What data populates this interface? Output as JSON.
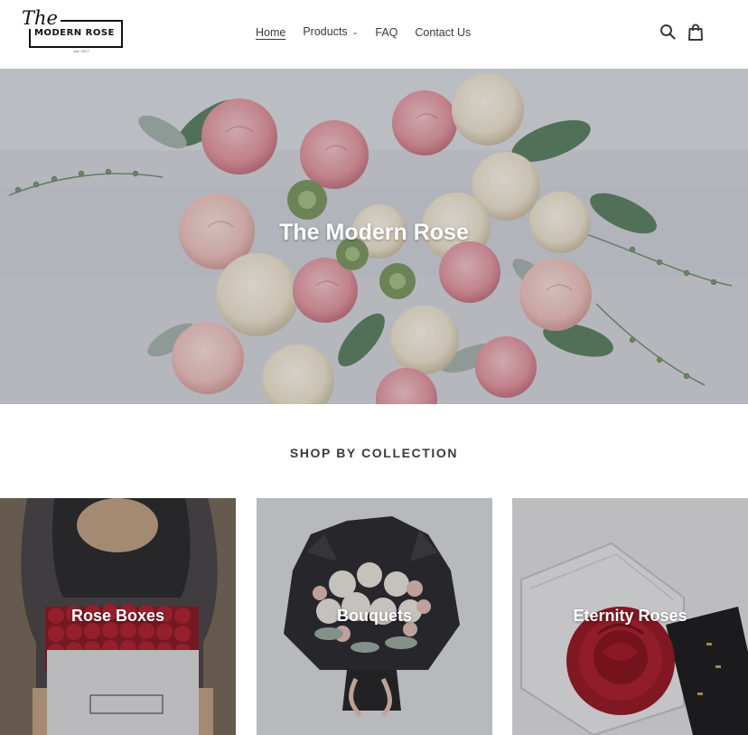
{
  "brand": {
    "script": "The",
    "name": "MODERN ROSE",
    "est": "est. 2017"
  },
  "nav": {
    "home": "Home",
    "products": "Products",
    "faq": "FAQ",
    "contact": "Contact Us"
  },
  "icons": {
    "search": "search-icon",
    "cart": "cart-icon",
    "caret": "chevron-down-icon"
  },
  "hero": {
    "title": "The Modern Rose"
  },
  "collections": {
    "heading": "SHOP BY COLLECTION",
    "items": [
      {
        "label": "Rose Boxes"
      },
      {
        "label": "Bouquets"
      },
      {
        "label": "Eternity Roses"
      }
    ]
  },
  "colors": {
    "text": "#3a3a3a",
    "background": "#ffffff",
    "rose_pink": "#e8a6ae",
    "rose_red": "#b3202c"
  }
}
